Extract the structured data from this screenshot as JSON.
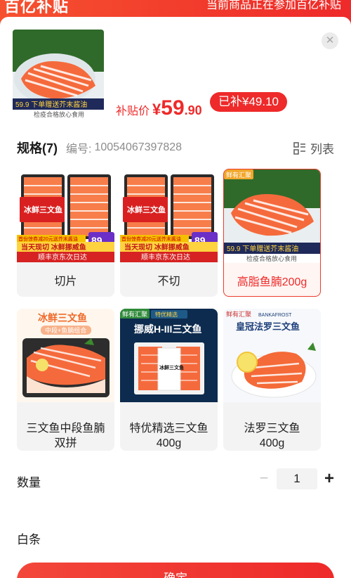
{
  "header": {
    "logo": "百亿补贴",
    "notice": "当前商品正在参加百亿补贴"
  },
  "product": {
    "thumb_caption": "检疫合格放心食用",
    "thumb_promo": "59.9 下单赠送芥末酱油",
    "price_label": "补贴价",
    "currency": "¥",
    "price_int": "59",
    "price_dec": ".90",
    "subsidy": "已补¥49.10"
  },
  "spec": {
    "title": "规格(7)",
    "code_label": "编号:",
    "code": "10054067397828",
    "list_label": "列表"
  },
  "options": [
    {
      "label": "切片",
      "selected": false,
      "banner_top": "冰鲜三文鱼",
      "strip1": "当天现切  冰鲜挪威鱼",
      "strip2": "顺丰京东次日达",
      "price": "89",
      "tag": "首份惊券减20元送芥末酱油"
    },
    {
      "label": "不切",
      "selected": false,
      "banner_top": "冰鲜三文鱼",
      "strip1": "当天现切  冰鲜挪威鱼",
      "strip2": "顺丰京东次日达",
      "price": "89",
      "tag": "首份惊券减20元送芥末酱油"
    },
    {
      "label": "高脂鱼腩200g",
      "selected": true,
      "brand": "鲜有汇聚",
      "promo": "59.9 下单赠送芥末酱油",
      "caption": "检疫合格放心食用"
    },
    {
      "label": "三文鱼中段鱼腩双拼",
      "line1": "三文鱼中段鱼腩",
      "line2": "双拼",
      "selected": false,
      "title": "冰鲜三文鱼",
      "subtitle": "中段+鱼腩组合"
    },
    {
      "label": "特优精选三文鱼400g",
      "line1": "特优精选三文鱼",
      "line2": "400g",
      "selected": false,
      "brand": "鲜有汇聚",
      "ribbon": "特优精选",
      "title": "挪威H-III三文鱼",
      "box": "冰鲜三文鱼"
    },
    {
      "label": "法罗三文鱼400g",
      "line1": "法罗三文鱼",
      "line2": "400g",
      "selected": false,
      "brand": "鲜有汇聚",
      "brand2": "BANKAFROST",
      "title": "皇冠法罗三文鱼"
    }
  ],
  "quantity": {
    "label": "数量",
    "value": "1",
    "minus": "−",
    "plus": "+"
  },
  "white_strip": {
    "label": "白条"
  },
  "confirm": {
    "label": "确定"
  },
  "colors": {
    "accent": "#ee2a2a",
    "header": "#f6512f",
    "salmon": "#f56a3c",
    "panel": "#f3f3f3"
  }
}
